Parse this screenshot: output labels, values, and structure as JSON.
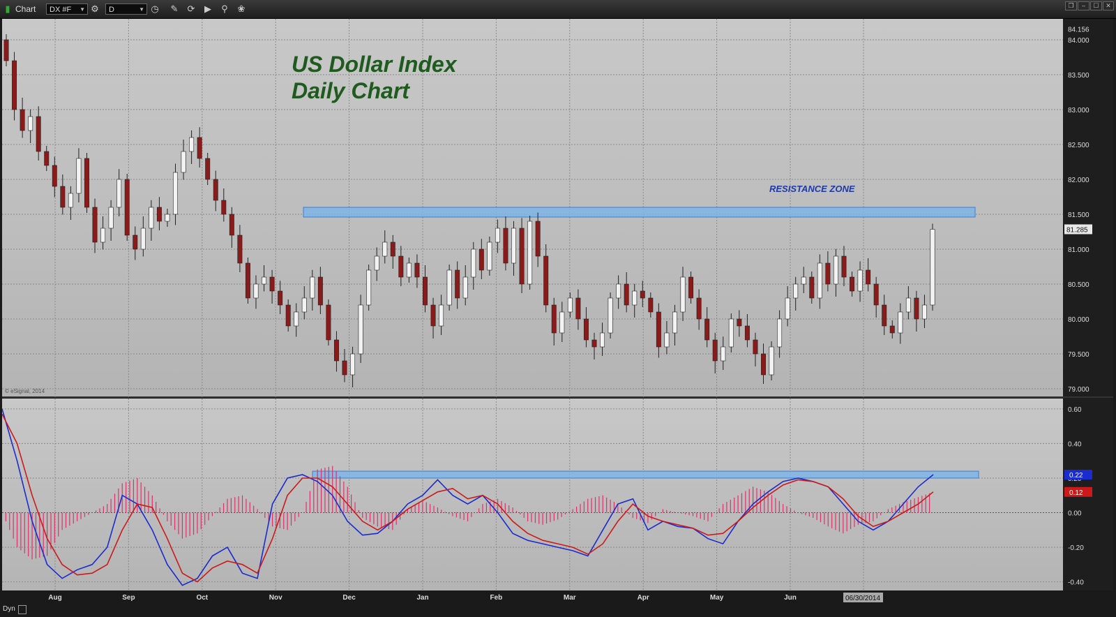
{
  "toolbar": {
    "app_label": "Chart",
    "symbol": "DX #F",
    "interval": "D"
  },
  "status": {
    "mode": "Dyn"
  },
  "copyright": "© eSignal, 2014",
  "chart_data": [
    {
      "type": "candlestick",
      "title": "US Dollar Index",
      "subtitle": "Daily Chart",
      "ylim": [
        78.88,
        84.3
      ],
      "y_ticks": [
        "84.156",
        "84.000",
        "83.500",
        "83.000",
        "82.500",
        "82.000",
        "81.500",
        "81.000",
        "80.500",
        "80.000",
        "79.500",
        "79.000"
      ],
      "last_price": "81.285",
      "x_months": [
        "Aug",
        "Sep",
        "Oct",
        "Nov",
        "Dec",
        "Jan",
        "Feb",
        "Mar",
        "Apr",
        "May",
        "Jun"
      ],
      "date_label": "06/30/2014",
      "annotation": "RESISTANCE ZONE",
      "resistance_zone": {
        "low": 81.46,
        "high": 81.6
      },
      "close_series": [
        83.7,
        83.0,
        82.7,
        82.9,
        82.4,
        82.2,
        81.9,
        81.6,
        81.8,
        82.3,
        81.6,
        81.1,
        81.3,
        81.6,
        82.0,
        81.2,
        81.0,
        81.3,
        81.6,
        81.4,
        81.5,
        82.1,
        82.4,
        82.6,
        82.3,
        82.0,
        81.7,
        81.5,
        81.2,
        80.8,
        80.3,
        80.5,
        80.6,
        80.4,
        80.2,
        79.9,
        80.1,
        80.3,
        80.6,
        80.2,
        79.7,
        79.4,
        79.2,
        79.5,
        80.2,
        80.7,
        80.9,
        81.1,
        80.9,
        80.6,
        80.8,
        80.6,
        80.2,
        79.9,
        80.2,
        80.7,
        80.3,
        80.6,
        81.0,
        80.7,
        81.1,
        81.3,
        80.8,
        81.3,
        80.5,
        81.4,
        80.9,
        80.2,
        79.8,
        80.1,
        80.3,
        80.0,
        79.7,
        79.6,
        79.8,
        80.3,
        80.5,
        80.2,
        80.4,
        80.3,
        80.1,
        79.6,
        79.8,
        80.1,
        80.6,
        80.3,
        80.0,
        79.7,
        79.4,
        79.6,
        80.0,
        79.9,
        79.7,
        79.5,
        79.2,
        79.6,
        80.0,
        80.3,
        80.5,
        80.6,
        80.3,
        80.8,
        80.5,
        80.9,
        80.6,
        80.4,
        80.7,
        80.5,
        80.2,
        79.9,
        79.8,
        80.1,
        80.3,
        80.0,
        80.2,
        81.285
      ],
      "series": [
        {
          "name": "",
          "values": [
            0.6,
            0.3,
            -0.05,
            -0.3,
            -0.38,
            -0.33,
            -0.3,
            -0.2,
            0.1,
            0.05,
            -0.1,
            -0.3,
            -0.42,
            -0.38,
            -0.25,
            -0.2,
            -0.35,
            -0.38,
            0.05,
            0.2,
            0.22,
            0.18,
            0.1,
            -0.05,
            -0.13,
            -0.12,
            -0.05,
            0.05,
            0.1,
            0.19,
            0.1,
            0.05,
            0.1,
            0.0,
            -0.12,
            -0.16,
            -0.18,
            -0.2,
            -0.22,
            -0.25,
            -0.1,
            0.05,
            0.08,
            -0.1,
            -0.05,
            -0.08,
            -0.09,
            -0.15,
            -0.18,
            -0.05,
            0.05,
            0.12,
            0.18,
            0.2,
            0.18,
            0.15,
            0.05,
            -0.05,
            -0.1,
            -0.05,
            0.05,
            0.15,
            0.22
          ]
        },
        {
          "name": "",
          "values": [
            0.57,
            0.4,
            0.1,
            -0.15,
            -0.3,
            -0.36,
            -0.35,
            -0.3,
            -0.1,
            0.05,
            0.03,
            -0.15,
            -0.35,
            -0.4,
            -0.32,
            -0.28,
            -0.3,
            -0.35,
            -0.15,
            0.1,
            0.2,
            0.2,
            0.15,
            0.05,
            -0.05,
            -0.1,
            -0.05,
            0.02,
            0.07,
            0.12,
            0.14,
            0.08,
            0.1,
            0.05,
            -0.05,
            -0.12,
            -0.16,
            -0.18,
            -0.2,
            -0.24,
            -0.18,
            -0.05,
            0.05,
            -0.02,
            -0.05,
            -0.07,
            -0.09,
            -0.13,
            -0.12,
            -0.05,
            0.03,
            0.1,
            0.16,
            0.19,
            0.18,
            0.15,
            0.08,
            -0.02,
            -0.08,
            -0.05,
            0.0,
            0.05,
            0.12
          ]
        },
        {
          "name": "",
          "values": [
            0.0,
            -0.2,
            -0.27,
            -0.25,
            -0.1,
            -0.05,
            0.0,
            0.05,
            0.17,
            0.2,
            0.1,
            -0.05,
            -0.15,
            -0.12,
            -0.02,
            0.08,
            0.1,
            0.02,
            -0.08,
            -0.1,
            0.0,
            0.25,
            0.27,
            0.15,
            -0.03,
            -0.08,
            -0.1,
            0.02,
            0.07,
            0.03,
            -0.02,
            -0.05,
            0.05,
            0.08,
            0.03,
            -0.05,
            -0.07,
            -0.04,
            0.02,
            0.08,
            0.1,
            0.05,
            -0.03,
            -0.06,
            0.02,
            0.0,
            -0.02,
            -0.05,
            0.05,
            0.1,
            0.15,
            0.12,
            0.05,
            0.0,
            -0.03,
            -0.08,
            -0.12,
            -0.07,
            -0.05,
            0.02,
            0.06,
            0.09,
            0.12
          ]
        }
      ],
      "ylim_osc": [
        -0.45,
        0.66
      ],
      "y_ticks_osc": [
        "0.60",
        "0.40",
        "0.20",
        "0.00",
        "-0.20",
        "-0.40"
      ],
      "osc_labels": [
        "0.22",
        "0.12"
      ],
      "osc_resistance": {
        "low": 0.2,
        "high": 0.24
      },
      "grid": true
    }
  ]
}
